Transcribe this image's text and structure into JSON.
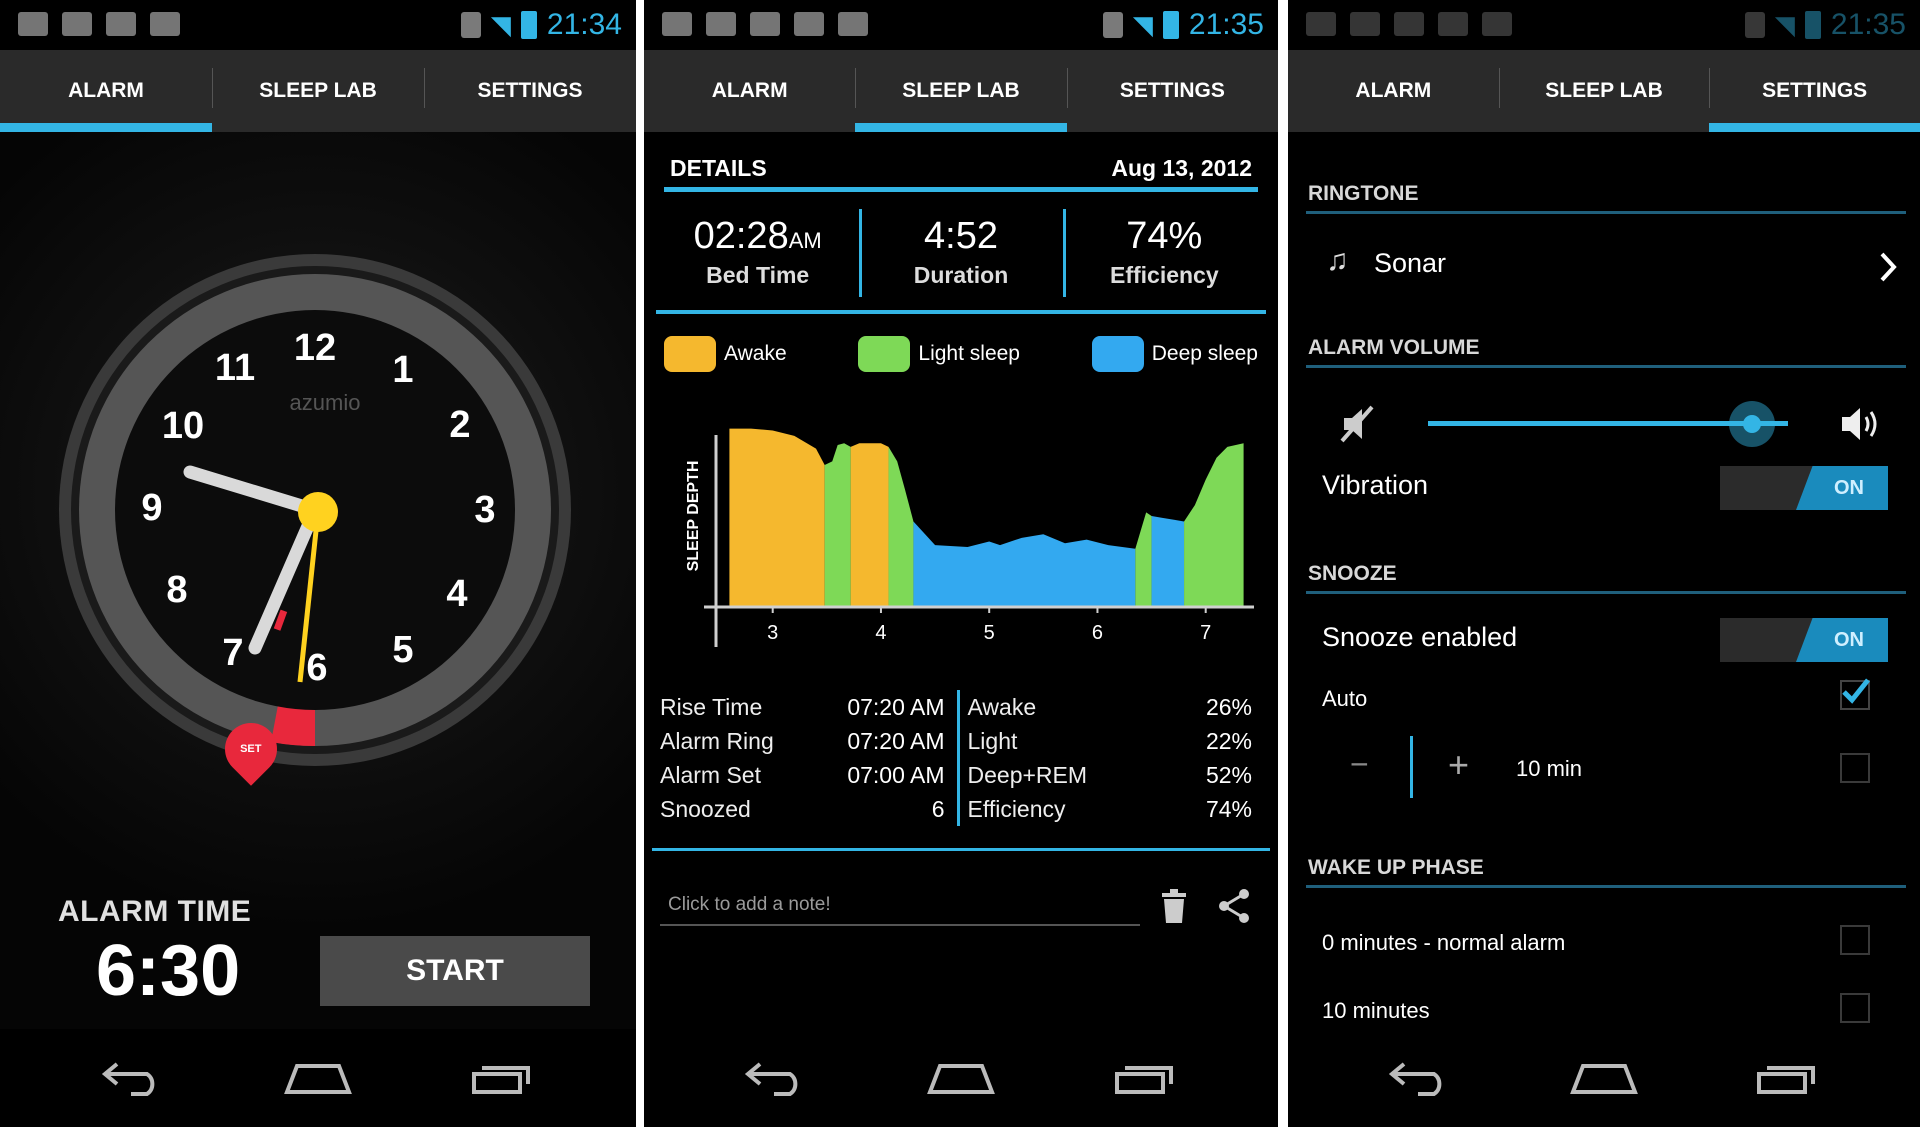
{
  "status_bar": {
    "times": [
      "21:34",
      "21:35",
      "21:35"
    ]
  },
  "tabs": [
    "ALARM",
    "SLEEP LAB",
    "SETTINGS"
  ],
  "alarm_screen": {
    "brand": "azumio",
    "clock_numbers": [
      "12",
      "1",
      "2",
      "3",
      "4",
      "5",
      "6",
      "7",
      "8",
      "9",
      "10",
      "11"
    ],
    "set_badge": "SET",
    "alarm_time_label": "ALARM TIME",
    "alarm_time_value": "6:30",
    "start_label": "START"
  },
  "sleep_lab": {
    "details_label": "DETAILS",
    "date": "Aug 13, 2012",
    "stats": [
      {
        "value": "02:28",
        "suffix": "AM",
        "label": "Bed Time"
      },
      {
        "value": "4:52",
        "suffix": "",
        "label": "Duration"
      },
      {
        "value": "74%",
        "suffix": "",
        "label": "Efficiency"
      }
    ],
    "legend": [
      {
        "name": "Awake",
        "color": "#f5b82e"
      },
      {
        "name": "Light sleep",
        "color": "#7ed957"
      },
      {
        "name": "Deep sleep",
        "color": "#33a9f0"
      }
    ],
    "info_left": [
      {
        "label": "Rise Time",
        "value": "07:20 AM"
      },
      {
        "label": "Alarm Ring",
        "value": "07:20 AM"
      },
      {
        "label": "Alarm Set",
        "value": "07:00 AM"
      },
      {
        "label": "Snoozed",
        "value": "6"
      }
    ],
    "info_right": [
      {
        "label": "Awake",
        "value": "26%"
      },
      {
        "label": "Light",
        "value": "22%"
      },
      {
        "label": "Deep+REM",
        "value": "52%"
      },
      {
        "label": "Efficiency",
        "value": "74%"
      }
    ],
    "note_placeholder": "Click to add a note!"
  },
  "chart_data": {
    "type": "area",
    "title": "",
    "xlabel": "",
    "ylabel": "SLEEP DEPTH",
    "x_ticks": [
      "3",
      "4",
      "5",
      "6",
      "7"
    ],
    "xlim": [
      2.55,
      7.4
    ],
    "ylim": [
      0,
      1
    ],
    "series": [
      {
        "name": "Awake",
        "color": "#f5b82e",
        "x": [
          2.6,
          2.8,
          3.0,
          3.2,
          3.4,
          3.48
        ],
        "y": [
          0.98,
          0.98,
          0.97,
          0.94,
          0.87,
          0.78
        ]
      },
      {
        "name": "Light sleep",
        "color": "#7ed957",
        "x": [
          3.48,
          3.55,
          3.6,
          3.66,
          3.72
        ],
        "y": [
          0.78,
          0.8,
          0.89,
          0.9,
          0.88
        ]
      },
      {
        "name": "Awake",
        "color": "#f5b82e",
        "x": [
          3.72,
          3.8,
          3.9,
          4.0,
          4.07
        ],
        "y": [
          0.88,
          0.9,
          0.9,
          0.9,
          0.88
        ]
      },
      {
        "name": "Light sleep",
        "color": "#7ed957",
        "x": [
          4.07,
          4.15,
          4.22,
          4.3
        ],
        "y": [
          0.88,
          0.8,
          0.65,
          0.47
        ]
      },
      {
        "name": "Deep sleep",
        "color": "#33a9f0",
        "x": [
          4.3,
          4.5,
          4.8,
          5.0,
          5.1,
          5.3,
          5.5,
          5.7,
          5.9,
          6.1,
          6.35
        ],
        "y": [
          0.47,
          0.34,
          0.33,
          0.36,
          0.34,
          0.38,
          0.4,
          0.35,
          0.37,
          0.34,
          0.32
        ]
      },
      {
        "name": "Light sleep",
        "color": "#7ed957",
        "x": [
          6.35,
          6.4,
          6.45,
          6.5
        ],
        "y": [
          0.32,
          0.42,
          0.52,
          0.5
        ]
      },
      {
        "name": "Deep sleep",
        "color": "#33a9f0",
        "x": [
          6.5,
          6.6,
          6.7,
          6.8
        ],
        "y": [
          0.5,
          0.49,
          0.48,
          0.47
        ]
      },
      {
        "name": "Light sleep",
        "color": "#7ed957",
        "x": [
          6.8,
          6.9,
          7.0,
          7.1,
          7.2,
          7.35
        ],
        "y": [
          0.47,
          0.56,
          0.7,
          0.82,
          0.88,
          0.9
        ]
      }
    ],
    "grid": false,
    "legend": "top"
  },
  "settings": {
    "ringtone_header": "RINGTONE",
    "ringtone_value": "Sonar",
    "alarm_volume_header": "ALARM VOLUME",
    "volume_level": 0.9,
    "vibration_label": "Vibration",
    "vibration_state": "ON",
    "snooze_header": "SNOOZE",
    "snooze_enabled_label": "Snooze enabled",
    "snooze_enabled_state": "ON",
    "auto_label": "Auto",
    "auto_checked": true,
    "minus_label": "−",
    "plus_label": "+",
    "snooze_value": "10 min",
    "wake_up_header": "WAKE UP PHASE",
    "wake_options": [
      "0 minutes - normal alarm",
      "10 minutes"
    ]
  },
  "colors": {
    "accent": "#33b5e5",
    "alarm_red": "#e8283c",
    "hand_yellow": "#ffd21f"
  }
}
